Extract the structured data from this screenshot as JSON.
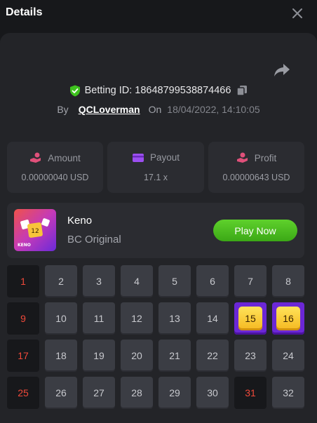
{
  "header": {
    "title": "Details"
  },
  "bet": {
    "id_label": "Betting ID:",
    "id_value": "18648799538874466",
    "by_label": "By",
    "user": "QCLoverman",
    "on_label": "On",
    "datetime": "18/04/2022, 14:10:05"
  },
  "stats": [
    {
      "label": "Amount",
      "value": "0.00000040 USD",
      "icon": "coins-hand-icon",
      "color": "#e0507a"
    },
    {
      "label": "Payout",
      "value": "17.1 x",
      "icon": "wallet-icon",
      "color": "#9c4ff0"
    },
    {
      "label": "Profit",
      "value": "0.00000643 USD",
      "icon": "money-hand-icon",
      "color": "#e0507a"
    }
  ],
  "game": {
    "name": "Keno",
    "provider": "BC Original",
    "play_label": "Play Now",
    "thumb_text": "KENO",
    "thumb_ball": "12"
  },
  "grid": {
    "cells": [
      {
        "n": "1",
        "state": "picked"
      },
      {
        "n": "2",
        "state": "normal"
      },
      {
        "n": "3",
        "state": "normal"
      },
      {
        "n": "4",
        "state": "normal"
      },
      {
        "n": "5",
        "state": "normal"
      },
      {
        "n": "6",
        "state": "normal"
      },
      {
        "n": "7",
        "state": "normal"
      },
      {
        "n": "8",
        "state": "normal"
      },
      {
        "n": "9",
        "state": "picked"
      },
      {
        "n": "10",
        "state": "normal"
      },
      {
        "n": "11",
        "state": "normal"
      },
      {
        "n": "12",
        "state": "normal"
      },
      {
        "n": "13",
        "state": "normal"
      },
      {
        "n": "14",
        "state": "normal"
      },
      {
        "n": "15",
        "state": "hit"
      },
      {
        "n": "16",
        "state": "hit"
      },
      {
        "n": "17",
        "state": "picked"
      },
      {
        "n": "18",
        "state": "normal"
      },
      {
        "n": "19",
        "state": "normal"
      },
      {
        "n": "20",
        "state": "normal"
      },
      {
        "n": "21",
        "state": "normal"
      },
      {
        "n": "22",
        "state": "normal"
      },
      {
        "n": "23",
        "state": "normal"
      },
      {
        "n": "24",
        "state": "normal"
      },
      {
        "n": "25",
        "state": "picked"
      },
      {
        "n": "26",
        "state": "normal"
      },
      {
        "n": "27",
        "state": "normal"
      },
      {
        "n": "28",
        "state": "normal"
      },
      {
        "n": "29",
        "state": "normal"
      },
      {
        "n": "30",
        "state": "normal"
      },
      {
        "n": "31",
        "state": "picked"
      },
      {
        "n": "32",
        "state": "normal"
      }
    ]
  },
  "colors": {
    "accent_green": "#3ba816",
    "hit_purple": "#6b27d6",
    "picked_red": "#f0493a"
  }
}
